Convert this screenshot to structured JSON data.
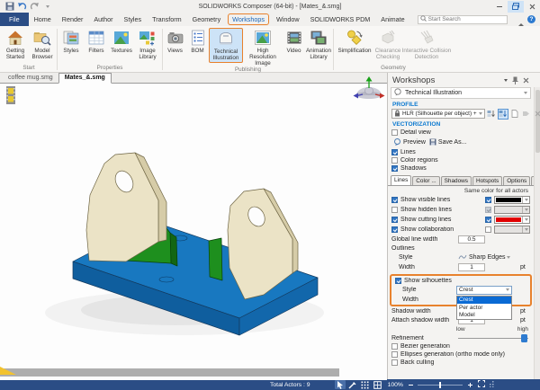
{
  "window": {
    "title": "SOLIDWORKS Composer (64-bit) - [Mates_&.smg]"
  },
  "menubar": {
    "tabs": [
      "File",
      "Home",
      "Render",
      "Author",
      "Styles",
      "Transform",
      "Geometry",
      "Workshops",
      "Window",
      "SOLIDWORKS PDM",
      "Animate"
    ],
    "search_placeholder": "Start Search",
    "help": "?"
  },
  "ribbon": {
    "groups": [
      {
        "label": "Start",
        "items": [
          {
            "label": "Getting Started"
          },
          {
            "label": "Model Browser"
          }
        ]
      },
      {
        "label": "Properties",
        "items": [
          {
            "label": "Styles"
          },
          {
            "label": "Filters"
          },
          {
            "label": "Textures"
          },
          {
            "label": "Image Library"
          }
        ]
      },
      {
        "label": "Publishing",
        "items": [
          {
            "label": "Views"
          },
          {
            "label": "BOM"
          },
          {
            "label": "Technical Illustration"
          },
          {
            "label": "High Resolution Image"
          },
          {
            "label": "Video"
          },
          {
            "label": "Animation Library"
          }
        ]
      },
      {
        "label": "Geometry",
        "items": [
          {
            "label": "Simplification"
          },
          {
            "label": "Clearance Checking"
          },
          {
            "label": "Interactive Collision Detection"
          }
        ]
      }
    ]
  },
  "doctabs": {
    "tabs": [
      {
        "label": "coffee mug.smg"
      },
      {
        "label": "Mates_&.smg"
      }
    ]
  },
  "workshops": {
    "title": "Workshops",
    "tool": "Technical Illustration",
    "profile_section": "PROFILE",
    "profile_value": "HLR (Silhouette per object) +",
    "vectorization_section": "VECTORIZATION",
    "detail_view": "Detail view",
    "preview": "Preview",
    "save_as": "Save As...",
    "lines": "Lines",
    "color_regions": "Color regions",
    "shadows": "Shadows",
    "tabs": [
      {
        "label": "Lines"
      },
      {
        "label": "Color ..."
      },
      {
        "label": "Shadows"
      },
      {
        "label": "Hotspots"
      },
      {
        "label": "Options"
      },
      {
        "label": "Multiple"
      }
    ],
    "same_color": "Same color for all actors",
    "show_visible_lines": "Show visible lines",
    "show_hidden_lines": "Show hidden lines",
    "show_cutting_lines": "Show cutting lines",
    "show_collaboration": "Show collaboration",
    "global_line_width_label": "Global line width",
    "global_line_width_value": "0.5",
    "outlines": "Outlines",
    "style_label": "Style",
    "style_value": "Sharp Edges",
    "width_label": "Width",
    "width_value": "1",
    "unit": "pt",
    "show_silhouettes": "Show silhouettes",
    "silhouette_style_label": "Style",
    "silhouette_style_value": "Crest",
    "silhouette_width_label": "Width",
    "style_options": [
      {
        "label": "Crest"
      },
      {
        "label": "Per actor"
      },
      {
        "label": "Model"
      }
    ],
    "shadow_width_label": "Shadow width",
    "attach_shadow_width_label": "Attach shadow width",
    "attach_shadow_width_value": "1",
    "low": "low",
    "high": "high",
    "refinement": "Refinement",
    "bezier": "Bezier generation",
    "ellipses": "Ellipses generation (ortho mode only)",
    "back_culling": "Back culling",
    "colors": {
      "visible_line_swatch": "#000000",
      "cutting_line_swatch": "#e00000",
      "accent_orange": "#e8822d",
      "selection_blue": "#0a6ad4"
    }
  },
  "statusbar": {
    "total_actors": "Total Actors : 9",
    "zoom_level": "100%"
  },
  "model": {
    "colors": {
      "base_plate": "#1878c0",
      "base_plate_side": "#0f5e9e",
      "base_plate_front": "#1267ab",
      "bracket": "#ebe3c6",
      "bracket_side": "#d6cca8",
      "wedge": "#1e8f1e",
      "wedge_side": "#136613",
      "wedge_top": "#2f9c2f"
    }
  }
}
